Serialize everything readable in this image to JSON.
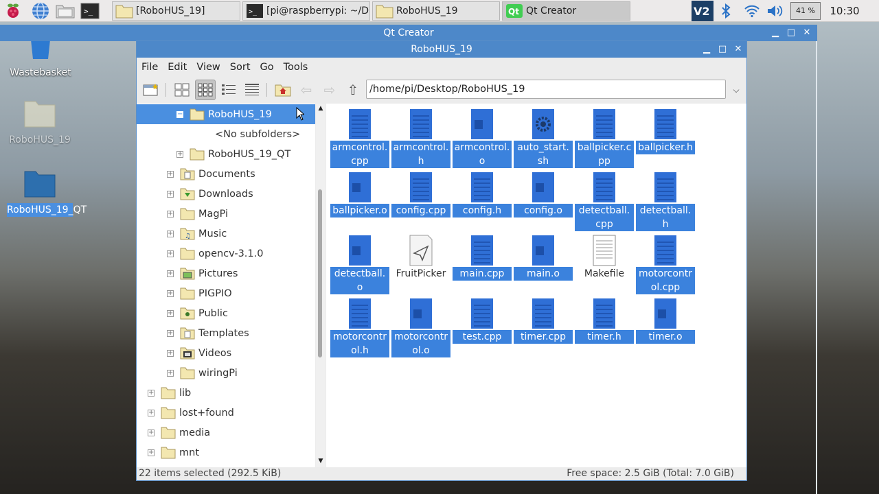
{
  "taskbar": {
    "tasks": [
      {
        "label": "[RoboHUS_19]"
      },
      {
        "label": "[pi@raspberrypi: ~/D..."
      },
      {
        "label": "RoboHUS_19"
      },
      {
        "label": "Qt Creator"
      }
    ],
    "battery": "41 %",
    "clock": "10:30"
  },
  "desktop": {
    "icons": [
      {
        "label": "Wastebasket"
      },
      {
        "label": "RoboHUS_19"
      },
      {
        "label": "RoboHUS_19_QT"
      }
    ]
  },
  "qt_window": {
    "title": "Qt Creator"
  },
  "file_manager": {
    "title": "RoboHUS_19",
    "menu": [
      "File",
      "Edit",
      "View",
      "Sort",
      "Go",
      "Tools"
    ],
    "path": "/home/pi/Desktop/RoboHUS_19",
    "tree": [
      {
        "label": "RoboHUS_19",
        "exp": "−"
      },
      {
        "label": "<No subfolders>",
        "exp": ""
      },
      {
        "label": "RoboHUS_19_QT",
        "exp": "+"
      },
      {
        "label": "Documents",
        "exp": "+"
      },
      {
        "label": "Downloads",
        "exp": "+"
      },
      {
        "label": "MagPi",
        "exp": "+"
      },
      {
        "label": "Music",
        "exp": "+"
      },
      {
        "label": "opencv-3.1.0",
        "exp": "+"
      },
      {
        "label": "Pictures",
        "exp": "+"
      },
      {
        "label": "PIGPIO",
        "exp": "+"
      },
      {
        "label": "Public",
        "exp": "+"
      },
      {
        "label": "Templates",
        "exp": "+"
      },
      {
        "label": "Videos",
        "exp": "+"
      },
      {
        "label": "wiringPi",
        "exp": "+"
      },
      {
        "label": "lib",
        "exp": "+"
      },
      {
        "label": "lost+found",
        "exp": "+"
      },
      {
        "label": "media",
        "exp": "+"
      },
      {
        "label": "mnt",
        "exp": "+"
      }
    ],
    "files": [
      {
        "label": "armcontrol.cpp",
        "kind": "text",
        "selected": true
      },
      {
        "label": "armcontrol.h",
        "kind": "text",
        "selected": true
      },
      {
        "label": "armcontrol.o",
        "kind": "obj",
        "selected": true
      },
      {
        "label": "auto_start.sh",
        "kind": "script",
        "selected": true
      },
      {
        "label": "ballpicker.cpp",
        "kind": "text",
        "selected": true
      },
      {
        "label": "ballpicker.h",
        "kind": "text",
        "selected": true
      },
      {
        "label": "ballpicker.o",
        "kind": "obj",
        "selected": true
      },
      {
        "label": "config.cpp",
        "kind": "text",
        "selected": true
      },
      {
        "label": "config.h",
        "kind": "text",
        "selected": true
      },
      {
        "label": "config.o",
        "kind": "obj",
        "selected": true
      },
      {
        "label": "detectball.cpp",
        "kind": "text",
        "selected": true
      },
      {
        "label": "detectball.h",
        "kind": "text",
        "selected": true
      },
      {
        "label": "detectball.o",
        "kind": "obj",
        "selected": true
      },
      {
        "label": "FruitPicker",
        "kind": "exec",
        "selected": false
      },
      {
        "label": "main.cpp",
        "kind": "text",
        "selected": true
      },
      {
        "label": "main.o",
        "kind": "obj",
        "selected": true
      },
      {
        "label": "Makefile",
        "kind": "plain",
        "selected": false
      },
      {
        "label": "motorcontrol.cpp",
        "kind": "text",
        "selected": true
      },
      {
        "label": "motorcontrol.h",
        "kind": "text",
        "selected": true
      },
      {
        "label": "motorcontrol.o",
        "kind": "obj",
        "selected": true
      },
      {
        "label": "test.cpp",
        "kind": "text",
        "selected": true
      },
      {
        "label": "timer.cpp",
        "kind": "text",
        "selected": true
      },
      {
        "label": "timer.h",
        "kind": "text",
        "selected": true
      },
      {
        "label": "timer.o",
        "kind": "obj",
        "selected": true
      }
    ],
    "status_left": "22 items selected (292.5 KiB)",
    "status_right": "Free space: 2.5 GiB (Total: 7.0 GiB)"
  },
  "colors": {
    "selection": "#3b82dd",
    "titlebar": "#4d88c9",
    "file_icon": "#2f6fd6"
  }
}
